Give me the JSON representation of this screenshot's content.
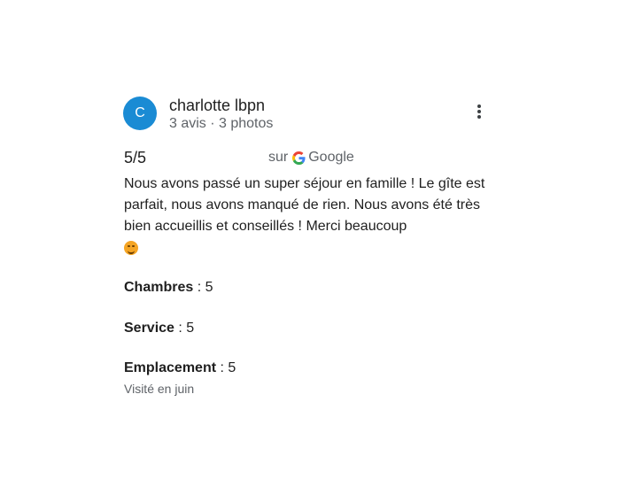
{
  "review": {
    "author": {
      "initial": "C",
      "name": "charlotte lbpn",
      "meta": "3 avis · 3 photos"
    },
    "rating": "5/5",
    "source_prefix": "sur",
    "source_name": "Google",
    "text": "Nous avons passé un super séjour en famille ! Le gîte est parfait, nous avons manqué de rien. Nous avons été très bien accueillis et conseillés ! Merci beaucoup",
    "emoji_icon": "smiling-face-emoji",
    "attributes": [
      {
        "label": "Chambres",
        "value": "5"
      },
      {
        "label": "Service",
        "value": "5"
      },
      {
        "label": "Emplacement",
        "value": "5"
      }
    ],
    "separator": " : ",
    "visited": "Visité en juin"
  },
  "colors": {
    "avatar": "#1a8bd4",
    "secondary_text": "#5f6368",
    "primary_text": "#1f1f1f"
  },
  "icons": {
    "menu": "more-vert-icon",
    "google": "google-g-icon"
  }
}
